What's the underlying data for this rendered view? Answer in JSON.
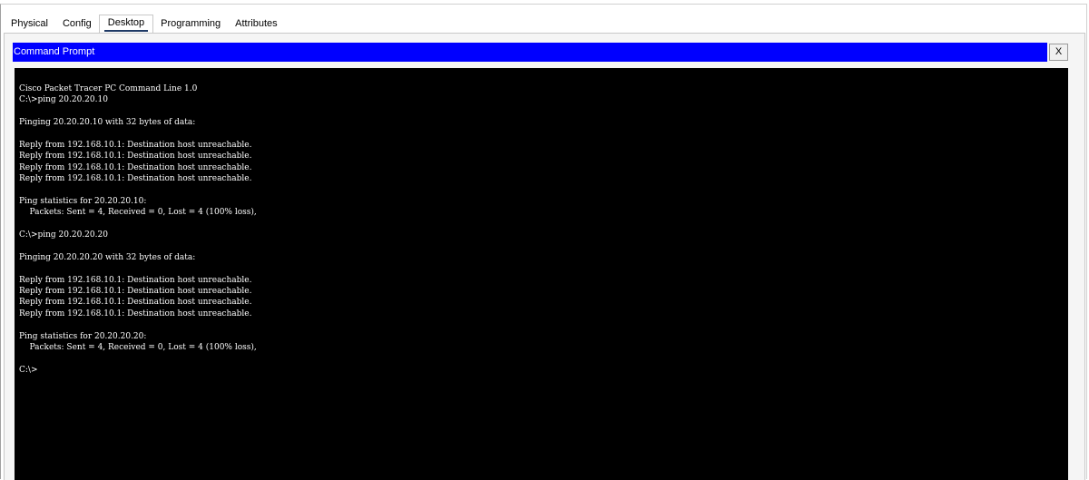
{
  "tabs": [
    {
      "label": "Physical",
      "active": false
    },
    {
      "label": "Config",
      "active": false
    },
    {
      "label": "Desktop",
      "active": true
    },
    {
      "label": "Programming",
      "active": false
    },
    {
      "label": "Attributes",
      "active": false
    }
  ],
  "window": {
    "title": "Command Prompt",
    "close_label": "X"
  },
  "terminal": {
    "lines": [
      "Cisco Packet Tracer PC Command Line 1.0",
      "C:\\>ping 20.20.20.10",
      "",
      "Pinging 20.20.20.10 with 32 bytes of data:",
      "",
      "Reply from 192.168.10.1: Destination host unreachable.",
      "Reply from 192.168.10.1: Destination host unreachable.",
      "Reply from 192.168.10.1: Destination host unreachable.",
      "Reply from 192.168.10.1: Destination host unreachable.",
      "",
      "Ping statistics for 20.20.20.10:",
      "    Packets: Sent = 4, Received = 0, Lost = 4 (100% loss),",
      "",
      "C:\\>ping 20.20.20.20",
      "",
      "Pinging 20.20.20.20 with 32 bytes of data:",
      "",
      "Reply from 192.168.10.1: Destination host unreachable.",
      "Reply from 192.168.10.1: Destination host unreachable.",
      "Reply from 192.168.10.1: Destination host unreachable.",
      "Reply from 192.168.10.1: Destination host unreachable.",
      "",
      "Ping statistics for 20.20.20.20:",
      "    Packets: Sent = 4, Received = 0, Lost = 4 (100% loss),",
      "",
      "C:\\>"
    ]
  }
}
